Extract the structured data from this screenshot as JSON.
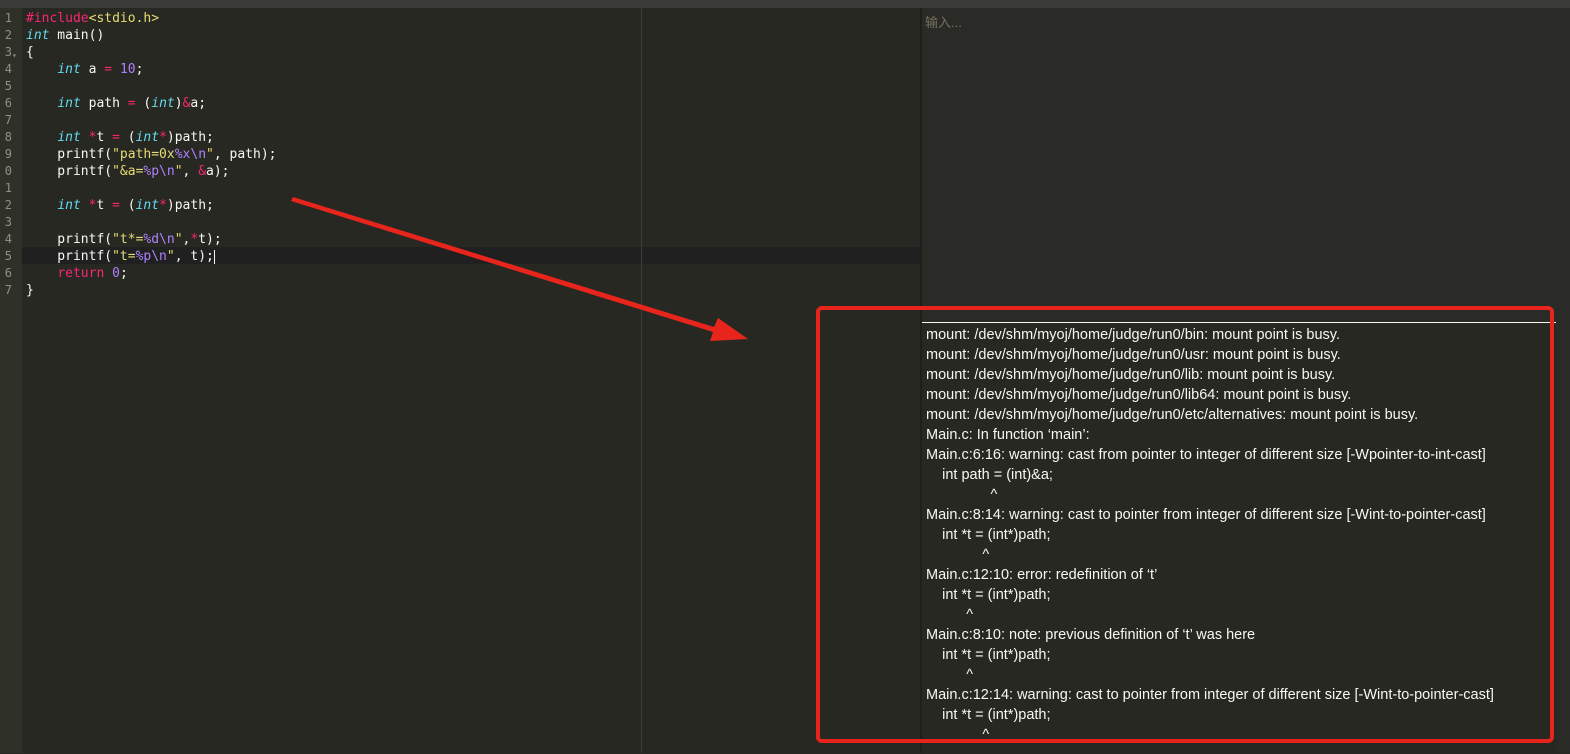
{
  "editor": {
    "line_numbers": [
      "1",
      "2",
      "3",
      "4",
      "5",
      "6",
      "7",
      "8",
      "9",
      "0",
      "1",
      "2",
      "3",
      "4",
      "5",
      "6",
      "7"
    ]
  },
  "input_panel": {
    "placeholder": "输入..."
  },
  "output": {
    "lines": [
      "mount: /dev/shm/myoj/home/judge/run0/bin: mount point is busy.",
      "mount: /dev/shm/myoj/home/judge/run0/usr: mount point is busy.",
      "mount: /dev/shm/myoj/home/judge/run0/lib: mount point is busy.",
      "mount: /dev/shm/myoj/home/judge/run0/lib64: mount point is busy.",
      "mount: /dev/shm/myoj/home/judge/run0/etc/alternatives: mount point is busy.",
      "Main.c: In function ‘main’:",
      "Main.c:6:16: warning: cast from pointer to integer of different size [-Wpointer-to-int-cast]",
      "    int path = (int)&a;",
      "                ^",
      "Main.c:8:14: warning: cast to pointer from integer of different size [-Wint-to-pointer-cast]",
      "    int *t = (int*)path;",
      "              ^",
      "Main.c:12:10: error: redefinition of ‘t’",
      "    int *t = (int*)path;",
      "          ^",
      "Main.c:8:10: note: previous definition of ‘t’ was here",
      "    int *t = (int*)path;",
      "          ^",
      "Main.c:12:14: warning: cast to pointer from integer of different size [-Wint-to-pointer-cast]",
      "    int *t = (int*)path;",
      "              ^"
    ]
  },
  "colors": {
    "editor_bg": "#272822",
    "annotation_red": "#e8251d"
  }
}
